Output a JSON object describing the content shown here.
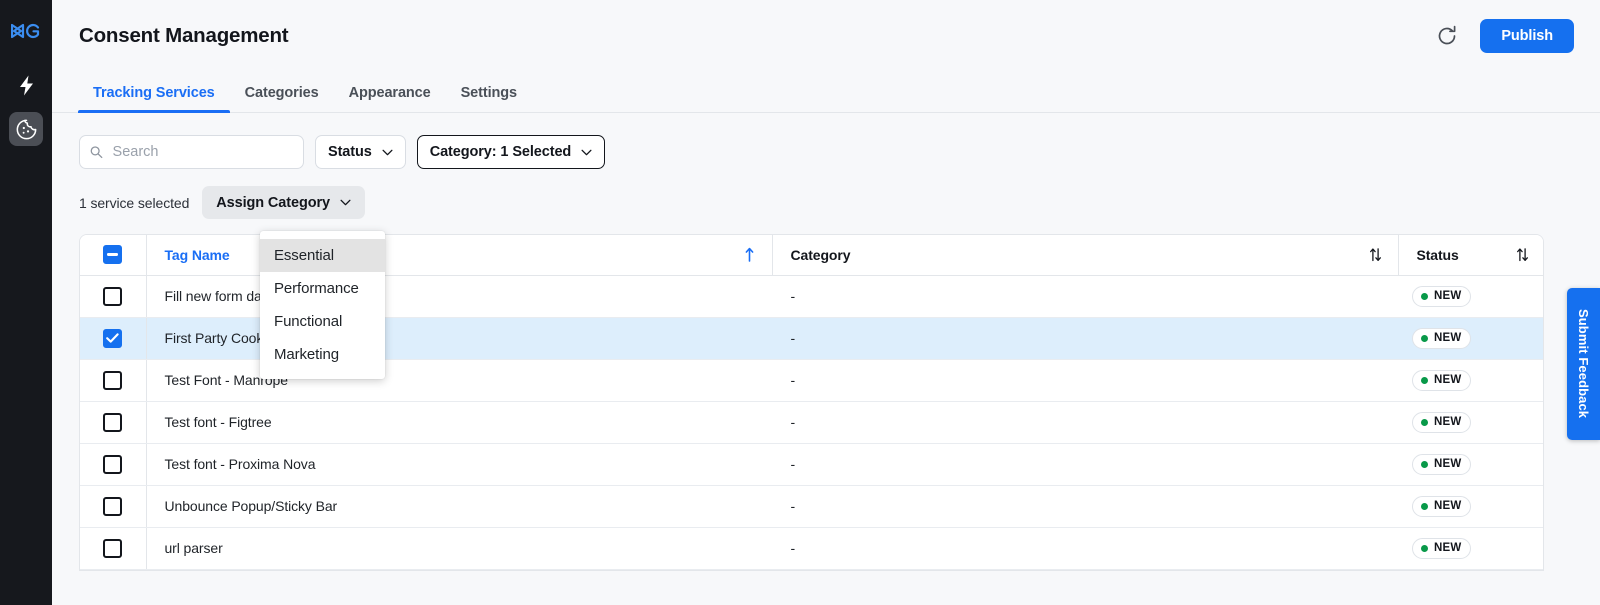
{
  "sidebar": {
    "logo_label": "DG",
    "items": [
      {
        "name": "lightning-icon",
        "label": "Activations",
        "active": false
      },
      {
        "name": "cookie-icon",
        "label": "Consent Management",
        "active": true
      }
    ]
  },
  "header": {
    "title": "Consent Management",
    "refresh_label": "Refresh",
    "publish_label": "Publish"
  },
  "tabs": [
    {
      "label": "Tracking Services",
      "active": true
    },
    {
      "label": "Categories",
      "active": false
    },
    {
      "label": "Appearance",
      "active": false
    },
    {
      "label": "Settings",
      "active": false
    }
  ],
  "filters": {
    "search_placeholder": "Search",
    "search_value": "",
    "status_label": "Status",
    "category_label": "Category: 1 Selected"
  },
  "selection": {
    "count_text": "1 service selected",
    "assign_label": "Assign Category"
  },
  "assign_dropdown": {
    "open": true,
    "options": [
      {
        "label": "Essential",
        "hovered": true
      },
      {
        "label": "Performance",
        "hovered": false
      },
      {
        "label": "Functional",
        "hovered": false
      },
      {
        "label": "Marketing",
        "hovered": false
      }
    ]
  },
  "table": {
    "columns": [
      {
        "key": "checkbox",
        "label": ""
      },
      {
        "key": "tag_name",
        "label": "Tag Name",
        "sort": "asc"
      },
      {
        "key": "category",
        "label": "Category",
        "sort": "none"
      },
      {
        "key": "status",
        "label": "Status",
        "sort": "none"
      }
    ],
    "header_checkbox_state": "indeterminate",
    "rows": [
      {
        "checked": false,
        "tag_name": "Fill new form data in cookie",
        "category": "-",
        "status": "NEW"
      },
      {
        "checked": true,
        "tag_name": "First Party Cookie",
        "category": "-",
        "status": "NEW"
      },
      {
        "checked": false,
        "tag_name": "Test Font - Manrope",
        "category": "-",
        "status": "NEW"
      },
      {
        "checked": false,
        "tag_name": "Test font - Figtree",
        "category": "-",
        "status": "NEW"
      },
      {
        "checked": false,
        "tag_name": "Test font - Proxima Nova",
        "category": "-",
        "status": "NEW"
      },
      {
        "checked": false,
        "tag_name": "Unbounce Popup/Sticky Bar",
        "category": "-",
        "status": "NEW"
      },
      {
        "checked": false,
        "tag_name": "url parser",
        "category": "-",
        "status": "NEW"
      }
    ]
  },
  "feedback": {
    "label": "Submit Feedback"
  },
  "colors": {
    "accent": "#1570ef",
    "tab_active": "#1a6ef5",
    "sidebar_bg": "#16181d",
    "page_bg": "#f7f8fa",
    "row_selected": "#ddeefc",
    "status_dot": "#089949"
  }
}
